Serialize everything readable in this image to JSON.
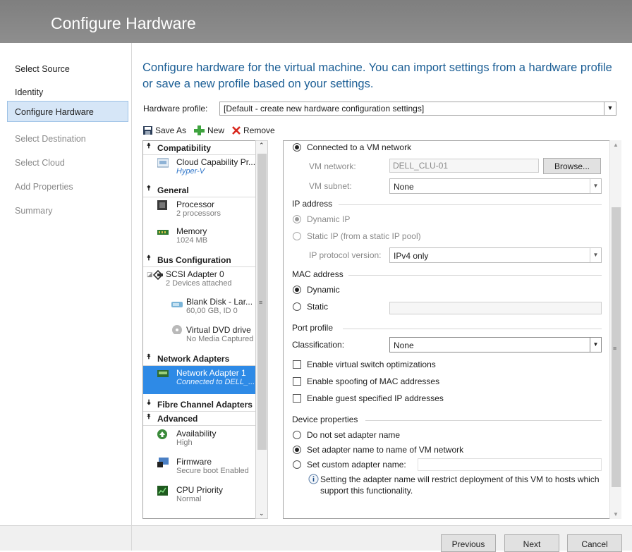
{
  "window": {
    "title": "Configure Hardware"
  },
  "steps": [
    {
      "label": "Select Source"
    },
    {
      "label": "Identity"
    },
    {
      "label": "Configure Hardware"
    },
    {
      "label": "Select Destination"
    },
    {
      "label": "Select Cloud"
    },
    {
      "label": "Add Properties"
    },
    {
      "label": "Summary"
    }
  ],
  "main": {
    "description": "Configure hardware for the virtual machine. You can import settings from a hardware profile or save a new profile based on your settings.",
    "hardware_profile_label": "Hardware profile:",
    "hardware_profile_value": "[Default - create new hardware configuration settings]"
  },
  "toolbar": {
    "save_as": "Save As",
    "new": "New",
    "remove": "Remove"
  },
  "tree": {
    "compatibility": "Compatibility",
    "cloud_capability": {
      "title": "Cloud Capability Pr...",
      "sub": "Hyper-V"
    },
    "general": "General",
    "processor": {
      "title": "Processor",
      "sub": "2 processors"
    },
    "memory": {
      "title": "Memory",
      "sub": "1024 MB"
    },
    "bus_configuration": "Bus Configuration",
    "scsi": {
      "title": "SCSI Adapter 0",
      "sub": "2 Devices attached"
    },
    "blank_disk": {
      "title": "Blank Disk - Lar...",
      "sub": "60,00 GB, ID 0"
    },
    "dvd": {
      "title": "Virtual DVD drive",
      "sub": "No Media Captured"
    },
    "network_adapters": "Network Adapters",
    "network_adapter_1": {
      "title": "Network Adapter 1",
      "sub": "Connected to DELL_..."
    },
    "fibre_channel": "Fibre Channel Adapters",
    "advanced": "Advanced",
    "availability": {
      "title": "Availability",
      "sub": "High"
    },
    "firmware": {
      "title": "Firmware",
      "sub": "Secure boot Enabled"
    },
    "cpu_priority": {
      "title": "CPU Priority",
      "sub": "Normal"
    }
  },
  "panel": {
    "connected_vm_network": "Connected to a VM network",
    "vm_network_label": "VM network:",
    "vm_network_value": "DELL_CLU-01",
    "browse": "Browse...",
    "vm_subnet_label": "VM subnet:",
    "vm_subnet_value": "None",
    "ip_address": "IP address",
    "dynamic_ip": "Dynamic IP",
    "static_ip": "Static IP (from a static IP pool)",
    "ip_protocol_label": "IP protocol version:",
    "ip_protocol_value": "IPv4 only",
    "mac_address": "MAC address",
    "mac_dynamic": "Dynamic",
    "mac_static": "Static",
    "port_profile": "Port profile",
    "classification_label": "Classification:",
    "classification_value": "None",
    "chk_vswitch": "Enable virtual switch optimizations",
    "chk_spoofing": "Enable spoofing of MAC addresses",
    "chk_guest_ip": "Enable guest specified IP addresses",
    "device_properties": "Device properties",
    "do_not_set_name": "Do not set adapter name",
    "set_name_vm_network": "Set adapter name to name of VM network",
    "set_custom_name": "Set custom adapter name:",
    "info_text": "Setting the adapter name will restrict deployment of this VM to hosts which support this functionality."
  },
  "footer": {
    "previous": "Previous",
    "next": "Next",
    "cancel": "Cancel"
  }
}
